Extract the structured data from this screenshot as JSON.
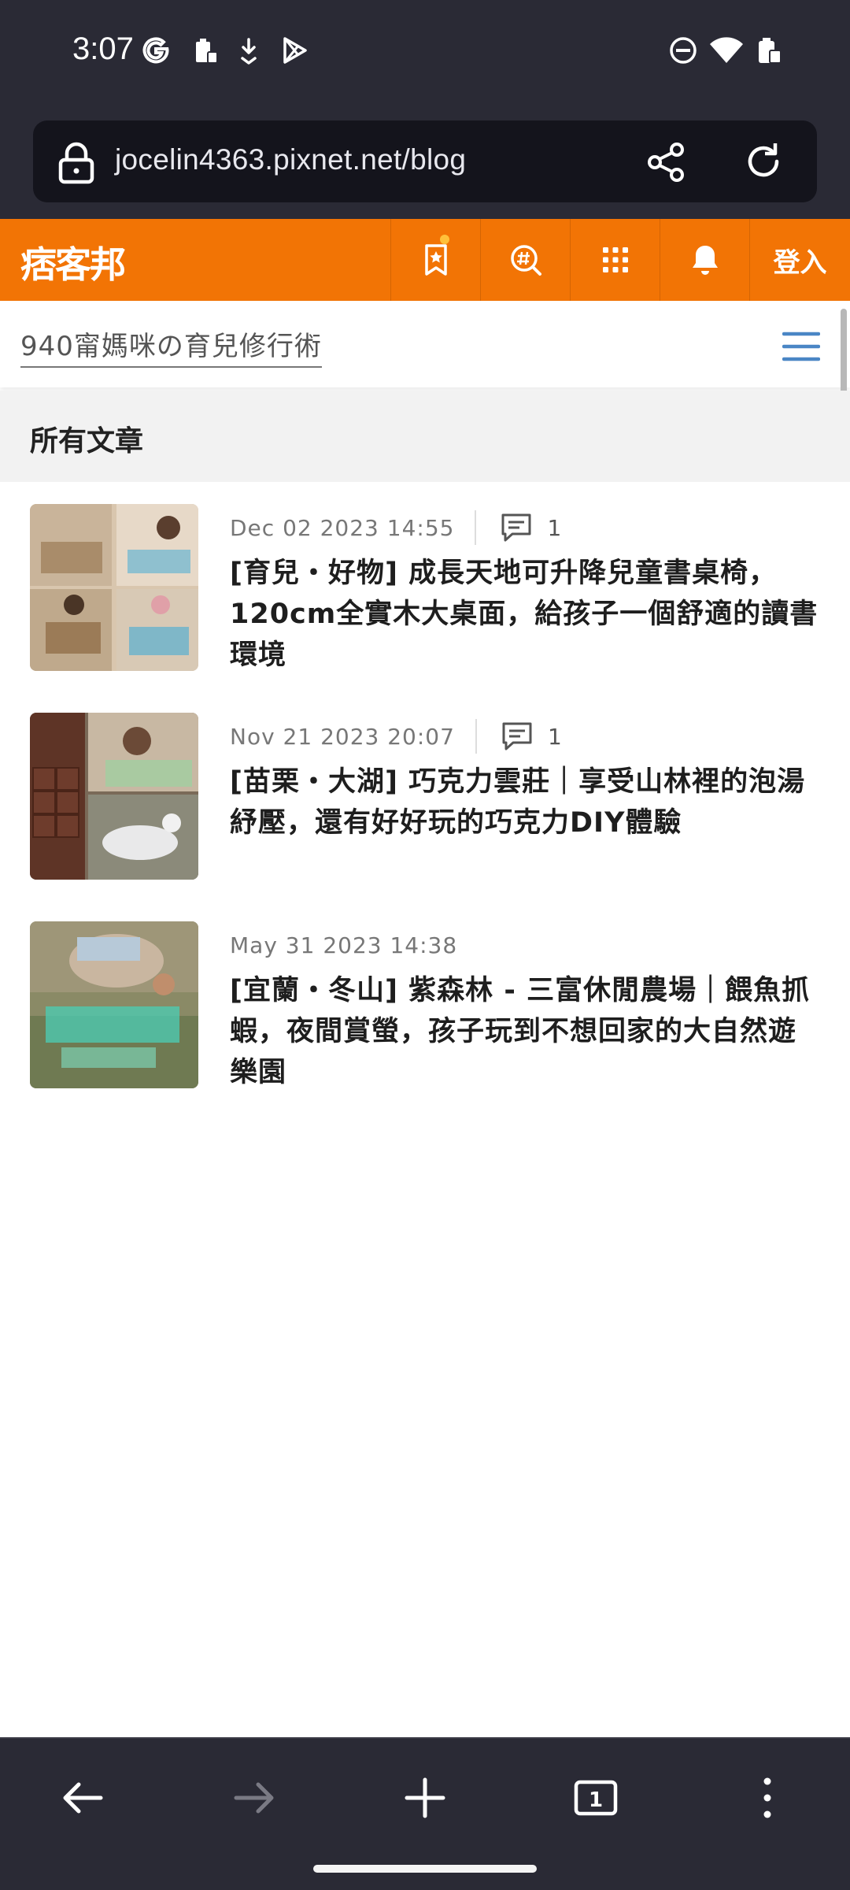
{
  "status_bar": {
    "time": "3:07",
    "icons": [
      "google-g-icon",
      "battery-saver-icon",
      "download-icon",
      "play-store-icon",
      "dnd-icon",
      "wifi-icon",
      "battery-icon"
    ]
  },
  "browser": {
    "url": "jocelin4363.pixnet.net/blog"
  },
  "site": {
    "logo": "痞客邦",
    "login_label": "登入",
    "accent": "#f27405"
  },
  "blog": {
    "title": "940甯媽咪の育兒修行術",
    "section_title": "所有文章"
  },
  "posts": [
    {
      "date": "Dec 02 2023 14:55",
      "comments": "1",
      "title": "[育兒・好物] 成長天地可升降兒童書桌椅，120cm全實木大桌面，給孩子一個舒適的讀書環境"
    },
    {
      "date": "Nov 21 2023 20:07",
      "comments": "1",
      "title": "[苗栗・大湖] 巧克力雲莊｜享受山林裡的泡湯紓壓，還有好好玩的巧克力DIY體驗"
    },
    {
      "date": "May 31 2023 14:38",
      "comments": "",
      "title": "[宜蘭・冬山] 紫森林 - 三富休閒農場｜餵魚抓蝦，夜間賞螢，孩子玩到不想回家的大自然遊樂園"
    }
  ],
  "toolbar": {
    "tab_count": "1"
  }
}
